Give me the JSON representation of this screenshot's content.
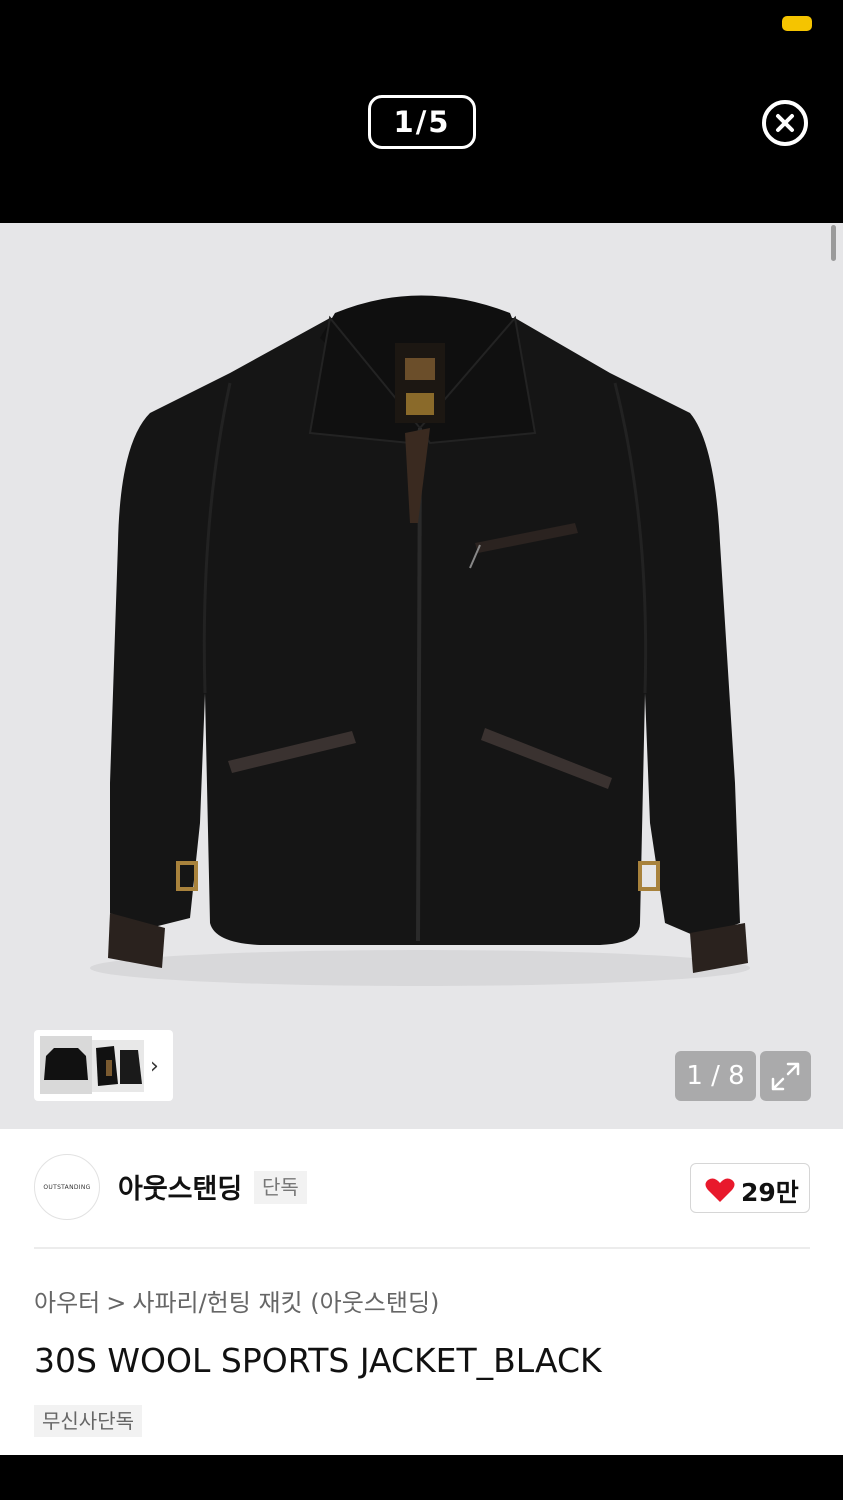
{
  "viewer": {
    "counter": "1/5",
    "close_icon": "close-circle-icon",
    "status_color": "#f5c400"
  },
  "product_image": {
    "alt": "jacket-photo",
    "image_counter": "1 / 8",
    "thumbnails_more_icon": "chevron-right-icon",
    "expand_icon": "expand-arrows-icon"
  },
  "brand": {
    "logo_text": "OUTSTANDING",
    "name": "아웃스탠딩",
    "tag": "단독",
    "like_icon": "heart-icon",
    "like_color": "#e8192c",
    "likes": "29만"
  },
  "breadcrumb": {
    "category": "아우터",
    "separator": ">",
    "subcategory": "사파리/헌팅 재킷 (아웃스탠딩)"
  },
  "product": {
    "title": "30S WOOL SPORTS JACKET_BLACK",
    "badge": "무신사단독"
  }
}
